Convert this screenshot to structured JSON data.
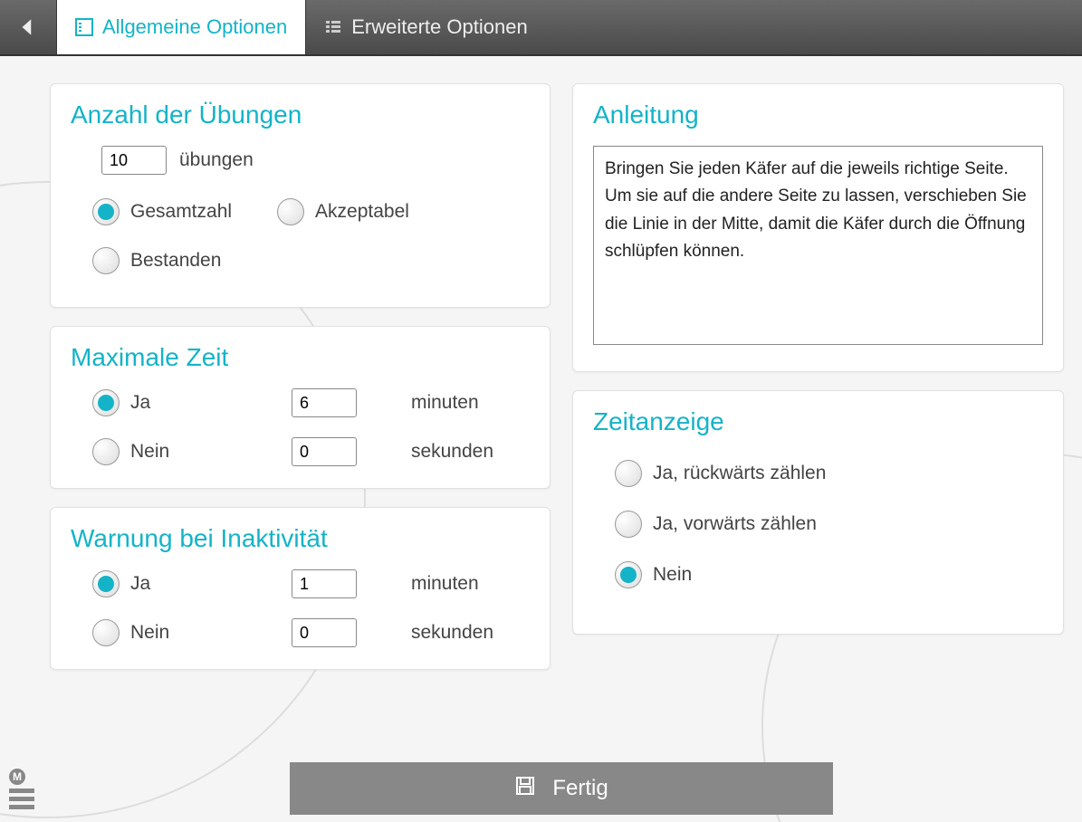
{
  "tabs": {
    "general": "Allgemeine Optionen",
    "advanced": "Erweiterte Optionen"
  },
  "exercises": {
    "title": "Anzahl der Übungen",
    "count_value": "10",
    "count_label": "übungen",
    "opt_total": "Gesamtzahl",
    "opt_acceptable": "Akzeptabel",
    "opt_passed": "Bestanden"
  },
  "maxtime": {
    "title": "Maximale Zeit",
    "yes": "Ja",
    "no": "Nein",
    "minutes_value": "6",
    "minutes_label": "minuten",
    "seconds_value": "0",
    "seconds_label": "sekunden"
  },
  "inactivity": {
    "title": "Warnung bei Inaktivität",
    "yes": "Ja",
    "no": "Nein",
    "minutes_value": "1",
    "minutes_label": "minuten",
    "seconds_value": "0",
    "seconds_label": "sekunden"
  },
  "instructions": {
    "title": "Anleitung",
    "text": "Bringen Sie jeden Käfer auf die jeweils richtige Seite.\nUm sie auf die andere Seite zu lassen, verschieben Sie die Linie in der Mitte, damit die Käfer durch die Öffnung schlüpfen können."
  },
  "timedisplay": {
    "title": "Zeitanzeige",
    "opt_countdown": "Ja, rückwärts zählen",
    "opt_countup": "Ja, vorwärts zählen",
    "opt_no": "Nein"
  },
  "footer": {
    "done": "Fertig"
  }
}
